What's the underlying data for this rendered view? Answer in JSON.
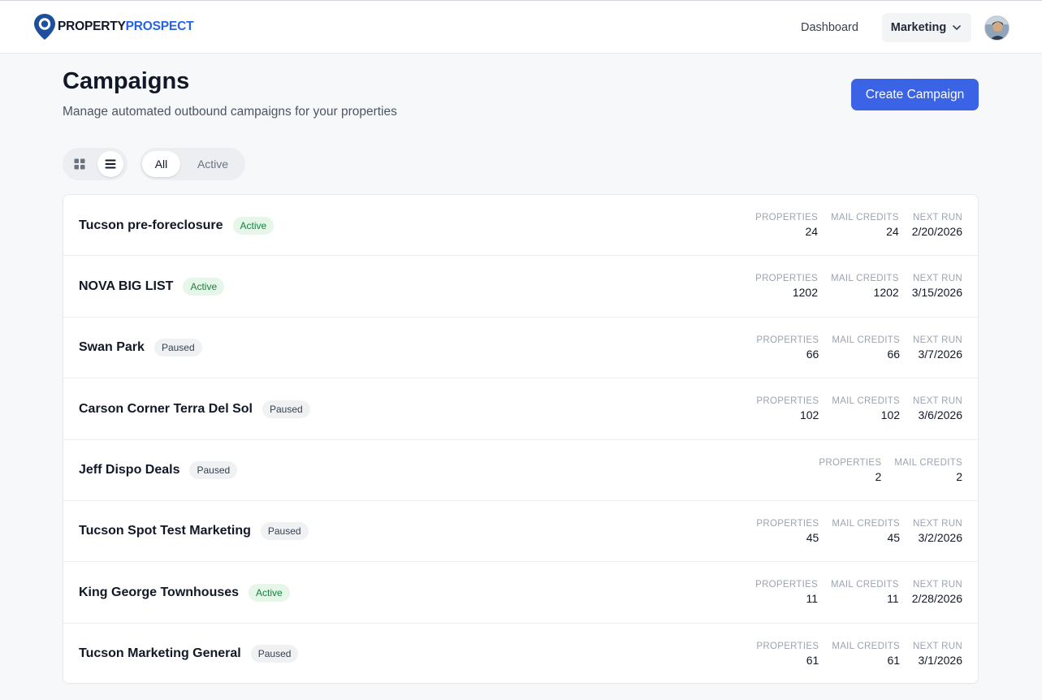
{
  "brand": {
    "part1": "PROPERTY",
    "part2": "PROSPECT",
    "accent": "#2563eb"
  },
  "nav": {
    "dashboard": "Dashboard",
    "marketing": "Marketing"
  },
  "header": {
    "title": "Campaigns",
    "subtitle": "Manage automated outbound campaigns for your properties",
    "create_label": "Create Campaign"
  },
  "filters": {
    "all": "All",
    "active": "Active"
  },
  "stat_labels": {
    "properties": "PROPERTIES",
    "mail_credits": "MAIL CREDITS",
    "next_run": "NEXT RUN"
  },
  "campaigns": [
    {
      "name": "Tucson pre-foreclosure",
      "status": "Active",
      "properties": "24",
      "mail_credits": "24",
      "next_run": "2/20/2026"
    },
    {
      "name": "NOVA BIG LIST",
      "status": "Active",
      "properties": "1202",
      "mail_credits": "1202",
      "next_run": "3/15/2026"
    },
    {
      "name": "Swan Park",
      "status": "Paused",
      "properties": "66",
      "mail_credits": "66",
      "next_run": "3/7/2026"
    },
    {
      "name": "Carson Corner Terra Del Sol",
      "status": "Paused",
      "properties": "102",
      "mail_credits": "102",
      "next_run": "3/6/2026"
    },
    {
      "name": "Jeff Dispo Deals",
      "status": "Paused",
      "properties": "2",
      "mail_credits": "2",
      "next_run": null
    },
    {
      "name": "Tucson Spot Test Marketing",
      "status": "Paused",
      "properties": "45",
      "mail_credits": "45",
      "next_run": "3/2/2026"
    },
    {
      "name": "King George Townhouses",
      "status": "Active",
      "properties": "11",
      "mail_credits": "11",
      "next_run": "2/28/2026"
    },
    {
      "name": "Tucson Marketing General",
      "status": "Paused",
      "properties": "61",
      "mail_credits": "61",
      "next_run": "3/1/2026"
    }
  ]
}
